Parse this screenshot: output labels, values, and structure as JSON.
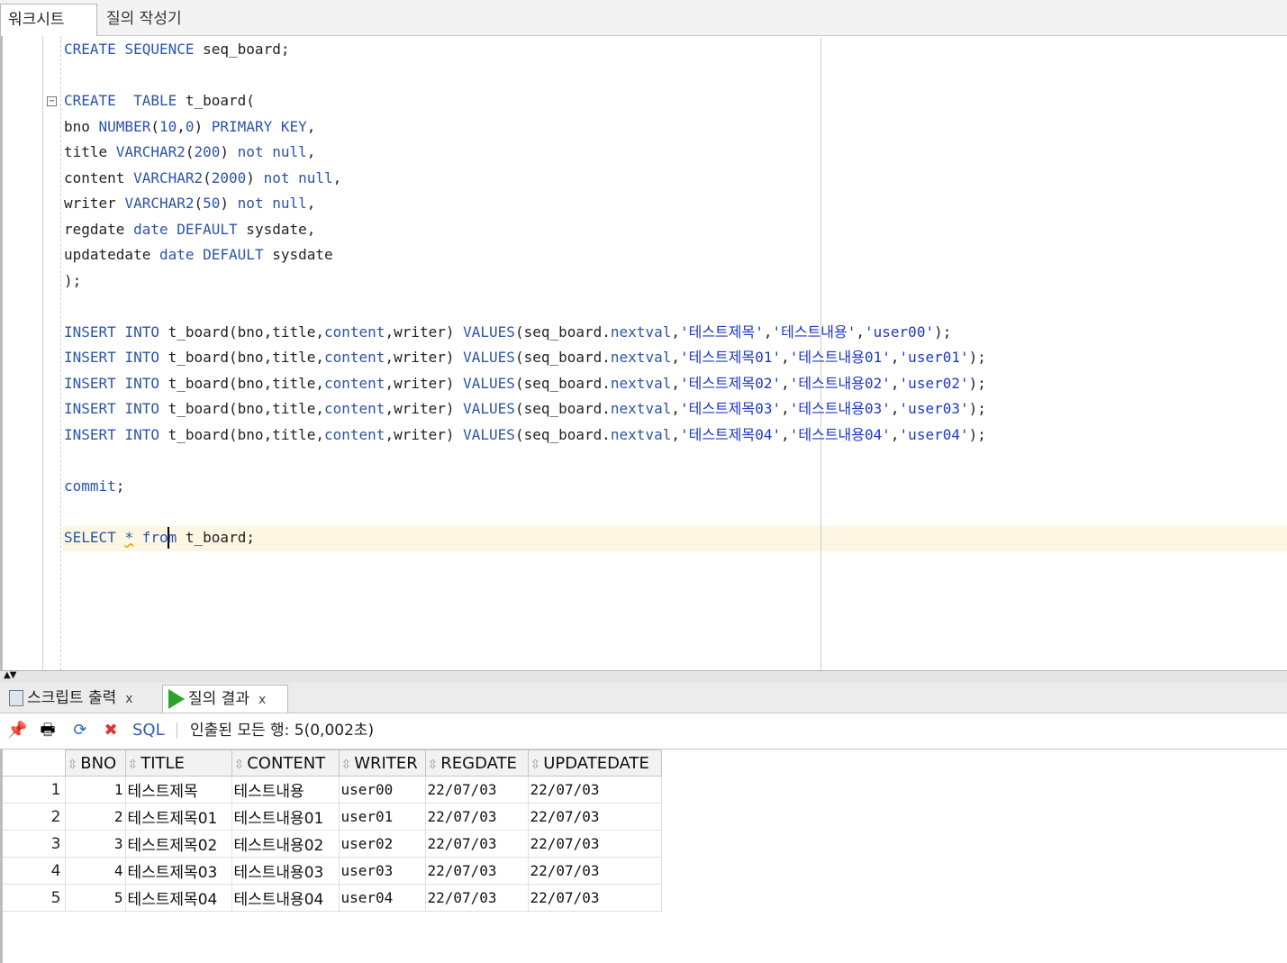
{
  "tabs": {
    "worksheet": "워크시트",
    "query_builder": "질의 작성기"
  },
  "editor": {
    "lines": [
      [
        {
          "t": "CREATE",
          "c": "kw"
        },
        {
          "t": " "
        },
        {
          "t": "SEQUENCE",
          "c": "kw"
        },
        {
          "t": " seq_board;"
        }
      ],
      [],
      [
        {
          "t": "CREATE",
          "c": "kw"
        },
        {
          "t": "  "
        },
        {
          "t": "TABLE",
          "c": "kw"
        },
        {
          "t": " t_board("
        }
      ],
      [
        {
          "t": "bno "
        },
        {
          "t": "NUMBER",
          "c": "kw"
        },
        {
          "t": "("
        },
        {
          "t": "10",
          "c": "num"
        },
        {
          "t": ","
        },
        {
          "t": "0",
          "c": "num"
        },
        {
          "t": ") "
        },
        {
          "t": "PRIMARY KEY",
          "c": "kw"
        },
        {
          "t": ","
        }
      ],
      [
        {
          "t": "title "
        },
        {
          "t": "VARCHAR2",
          "c": "kw"
        },
        {
          "t": "("
        },
        {
          "t": "200",
          "c": "num"
        },
        {
          "t": ") "
        },
        {
          "t": "not null",
          "c": "kw"
        },
        {
          "t": ","
        }
      ],
      [
        {
          "t": "content "
        },
        {
          "t": "VARCHAR2",
          "c": "kw"
        },
        {
          "t": "("
        },
        {
          "t": "2000",
          "c": "num"
        },
        {
          "t": ") "
        },
        {
          "t": "not null",
          "c": "kw"
        },
        {
          "t": ","
        }
      ],
      [
        {
          "t": "writer "
        },
        {
          "t": "VARCHAR2",
          "c": "kw"
        },
        {
          "t": "("
        },
        {
          "t": "50",
          "c": "num"
        },
        {
          "t": ") "
        },
        {
          "t": "not null",
          "c": "kw"
        },
        {
          "t": ","
        }
      ],
      [
        {
          "t": "regdate "
        },
        {
          "t": "date",
          "c": "kw"
        },
        {
          "t": " "
        },
        {
          "t": "DEFAULT",
          "c": "kw"
        },
        {
          "t": " sysdate,"
        }
      ],
      [
        {
          "t": "updatedate "
        },
        {
          "t": "date",
          "c": "kw"
        },
        {
          "t": " "
        },
        {
          "t": "DEFAULT",
          "c": "kw"
        },
        {
          "t": " sysdate"
        }
      ],
      [
        {
          "t": ");"
        }
      ],
      [],
      [
        {
          "t": "INSERT",
          "c": "kw"
        },
        {
          "t": " "
        },
        {
          "t": "INTO",
          "c": "kw"
        },
        {
          "t": " t_board(bno,title,"
        },
        {
          "t": "content",
          "c": "kw"
        },
        {
          "t": ",writer) "
        },
        {
          "t": "VALUES",
          "c": "kw"
        },
        {
          "t": "(seq_board."
        },
        {
          "t": "nextval",
          "c": "kw"
        },
        {
          "t": ","
        },
        {
          "t": "'테스트제목'",
          "c": "str"
        },
        {
          "t": ","
        },
        {
          "t": "'테스트내용'",
          "c": "str"
        },
        {
          "t": ","
        },
        {
          "t": "'user00'",
          "c": "str"
        },
        {
          "t": ");"
        }
      ],
      [
        {
          "t": "INSERT",
          "c": "kw"
        },
        {
          "t": " "
        },
        {
          "t": "INTO",
          "c": "kw"
        },
        {
          "t": " t_board(bno,title,"
        },
        {
          "t": "content",
          "c": "kw"
        },
        {
          "t": ",writer) "
        },
        {
          "t": "VALUES",
          "c": "kw"
        },
        {
          "t": "(seq_board."
        },
        {
          "t": "nextval",
          "c": "kw"
        },
        {
          "t": ","
        },
        {
          "t": "'테스트제목01'",
          "c": "str"
        },
        {
          "t": ","
        },
        {
          "t": "'테스트내용01'",
          "c": "str"
        },
        {
          "t": ","
        },
        {
          "t": "'user01'",
          "c": "str"
        },
        {
          "t": ");"
        }
      ],
      [
        {
          "t": "INSERT",
          "c": "kw"
        },
        {
          "t": " "
        },
        {
          "t": "INTO",
          "c": "kw"
        },
        {
          "t": " t_board(bno,title,"
        },
        {
          "t": "content",
          "c": "kw"
        },
        {
          "t": ",writer) "
        },
        {
          "t": "VALUES",
          "c": "kw"
        },
        {
          "t": "(seq_board."
        },
        {
          "t": "nextval",
          "c": "kw"
        },
        {
          "t": ","
        },
        {
          "t": "'테스트제목02'",
          "c": "str"
        },
        {
          "t": ","
        },
        {
          "t": "'테스트내용02'",
          "c": "str"
        },
        {
          "t": ","
        },
        {
          "t": "'user02'",
          "c": "str"
        },
        {
          "t": ");"
        }
      ],
      [
        {
          "t": "INSERT",
          "c": "kw"
        },
        {
          "t": " "
        },
        {
          "t": "INTO",
          "c": "kw"
        },
        {
          "t": " t_board(bno,title,"
        },
        {
          "t": "content",
          "c": "kw"
        },
        {
          "t": ",writer) "
        },
        {
          "t": "VALUES",
          "c": "kw"
        },
        {
          "t": "(seq_board."
        },
        {
          "t": "nextval",
          "c": "kw"
        },
        {
          "t": ","
        },
        {
          "t": "'테스트제목03'",
          "c": "str"
        },
        {
          "t": ","
        },
        {
          "t": "'테스트내용03'",
          "c": "str"
        },
        {
          "t": ","
        },
        {
          "t": "'user03'",
          "c": "str"
        },
        {
          "t": ");"
        }
      ],
      [
        {
          "t": "INSERT",
          "c": "kw"
        },
        {
          "t": " "
        },
        {
          "t": "INTO",
          "c": "kw"
        },
        {
          "t": " t_board(bno,title,"
        },
        {
          "t": "content",
          "c": "kw"
        },
        {
          "t": ",writer) "
        },
        {
          "t": "VALUES",
          "c": "kw"
        },
        {
          "t": "(seq_board."
        },
        {
          "t": "nextval",
          "c": "kw"
        },
        {
          "t": ","
        },
        {
          "t": "'테스트제목04'",
          "c": "str"
        },
        {
          "t": ","
        },
        {
          "t": "'테스트내용04'",
          "c": "str"
        },
        {
          "t": ","
        },
        {
          "t": "'user04'",
          "c": "str"
        },
        {
          "t": ");"
        }
      ],
      [],
      [
        {
          "t": "commit",
          "c": "kw"
        },
        {
          "t": ";"
        }
      ],
      [],
      [
        {
          "t": "SELECT",
          "c": "kw"
        },
        {
          "t": " "
        },
        {
          "t": "*",
          "c": "kw squig"
        },
        {
          "t": " "
        },
        {
          "t": "fro",
          "c": "kw"
        },
        {
          "caret": true
        },
        {
          "t": "m",
          "c": "kw"
        },
        {
          "t": " t_board;"
        }
      ]
    ]
  },
  "results_tabs": {
    "script_output": "스크립트 출력",
    "query_result": "질의 결과",
    "close": "x"
  },
  "toolbar": {
    "sql_label": "SQL",
    "status": "인출된 모든 행: 5(0,002초)"
  },
  "grid": {
    "columns": [
      "BNO",
      "TITLE",
      "CONTENT",
      "WRITER",
      "REGDATE",
      "UPDATEDATE"
    ],
    "rows": [
      [
        "1",
        "1",
        "테스트제목",
        "테스트내용",
        "user00",
        "22/07/03",
        "22/07/03"
      ],
      [
        "2",
        "2",
        "테스트제목01",
        "테스트내용01",
        "user01",
        "22/07/03",
        "22/07/03"
      ],
      [
        "3",
        "3",
        "테스트제목02",
        "테스트내용02",
        "user02",
        "22/07/03",
        "22/07/03"
      ],
      [
        "4",
        "4",
        "테스트제목03",
        "테스트내용03",
        "user03",
        "22/07/03",
        "22/07/03"
      ],
      [
        "5",
        "5",
        "테스트제목04",
        "테스트내용04",
        "user04",
        "22/07/03",
        "22/07/03"
      ]
    ]
  },
  "icons": {
    "pin": "pin-icon",
    "print": "print-icon",
    "refresh": "refresh-icon",
    "clear": "clear-icon"
  }
}
